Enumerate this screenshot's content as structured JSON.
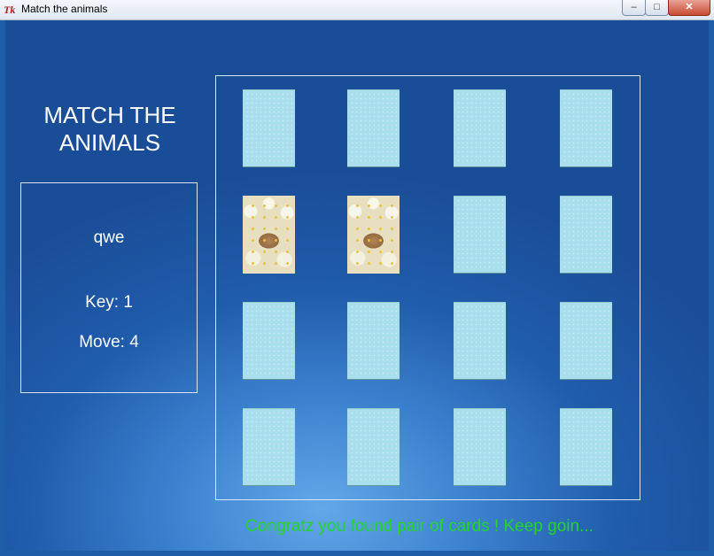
{
  "window": {
    "title": "Match the animals",
    "controls": {
      "minimize": "–",
      "maximize": "□",
      "close": "✕"
    }
  },
  "game": {
    "title_lines": [
      "MATCH THE",
      "ANIMALS"
    ],
    "player_name": "qwe",
    "key_text": "Key: 1",
    "move_text": "Move: 4",
    "status_message": "Congratz you found pair of cards ! Keep goin...",
    "status_color": "#22d62b",
    "card_back_color": "#a9dfec",
    "grid": {
      "rows": 4,
      "cols": 4,
      "cards": [
        {
          "state": "hidden"
        },
        {
          "state": "hidden"
        },
        {
          "state": "hidden"
        },
        {
          "state": "hidden"
        },
        {
          "state": "revealed",
          "animal": "guinea pig in daisies"
        },
        {
          "state": "revealed",
          "animal": "guinea pig in daisies"
        },
        {
          "state": "hidden"
        },
        {
          "state": "hidden"
        },
        {
          "state": "hidden"
        },
        {
          "state": "hidden"
        },
        {
          "state": "hidden"
        },
        {
          "state": "hidden"
        },
        {
          "state": "hidden"
        },
        {
          "state": "hidden"
        },
        {
          "state": "hidden"
        },
        {
          "state": "hidden"
        }
      ]
    }
  }
}
